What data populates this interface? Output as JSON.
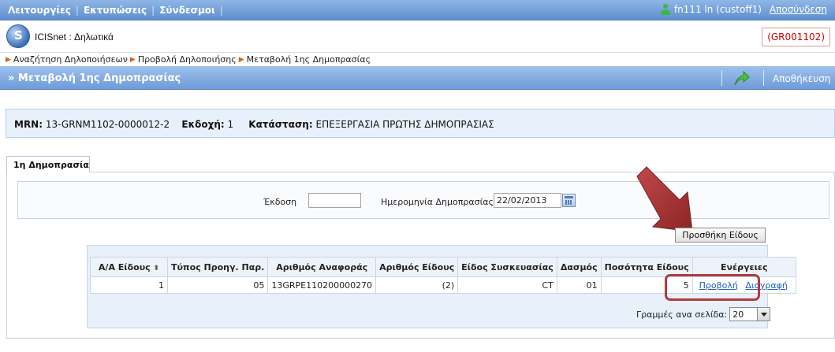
{
  "topmenu": {
    "items": [
      "Λειτουργίες",
      "Εκτυπώσεις",
      "Σύνδεσμοι"
    ],
    "user": "fn111 ln (custoff1)",
    "logout": "Αποσύνδεση"
  },
  "app": {
    "title": "ICISnet : Δηλωτικά",
    "office_code": "(GR001102)"
  },
  "breadcrumb": [
    "Αναζήτηση Δηλοποιήσεων",
    "Προβολή Δηλοποιήσης",
    "Μεταβολή 1ης Δημοπρασίας"
  ],
  "section": {
    "title": "» Μεταβολή 1ης Δημοπρασίας",
    "save_label": "Αποθήκευση"
  },
  "info": {
    "mrn_label": "MRN:",
    "mrn_value": "13-GRNM1102-0000012-2",
    "version_label": "Εκδοχή:",
    "version_value": "1",
    "status_label": "Κατάσταση:",
    "status_value": "ΕΠΕΞΕΡΓΑΣΙΑ ΠΡΩΤΗΣ ΔΗΜΟΠΡΑΣΙΑΣ"
  },
  "tab": {
    "label": "1η Δημοπρασία"
  },
  "form": {
    "version_label": "Έκδοση",
    "version_value": "",
    "date_label": "Ημερομηνία Δημοπρασίας",
    "date_value": "22/02/2013"
  },
  "add_button": "Προσθήκη Είδους",
  "grid": {
    "columns": [
      "Α/Α Είδους",
      "Τύπος Προηγ. Παρ.",
      "Αριθμός Αναφοράς",
      "Αριθμός Είδους",
      "Είδος Συσκευασίας",
      "Δασμός",
      "Ποσότητα Είδους",
      "Ενέργειες"
    ],
    "sort_indicator": "⬍",
    "rows": [
      {
        "aa": "1",
        "type": "05",
        "ref": "13GRPE110200000270",
        "item_no": "(2)",
        "pack": "CT",
        "duty": "01",
        "qty": "5",
        "view": "Προβολή",
        "delete": "Διαγραφή"
      }
    ]
  },
  "pager": {
    "label": "Γραμμές ανα σελίδα:",
    "value": "20"
  },
  "colors": {
    "menubar": "#6f9bd8",
    "highlight": "#b23a3f",
    "arrow": "#a3302f",
    "link": "#1f5fb9"
  }
}
